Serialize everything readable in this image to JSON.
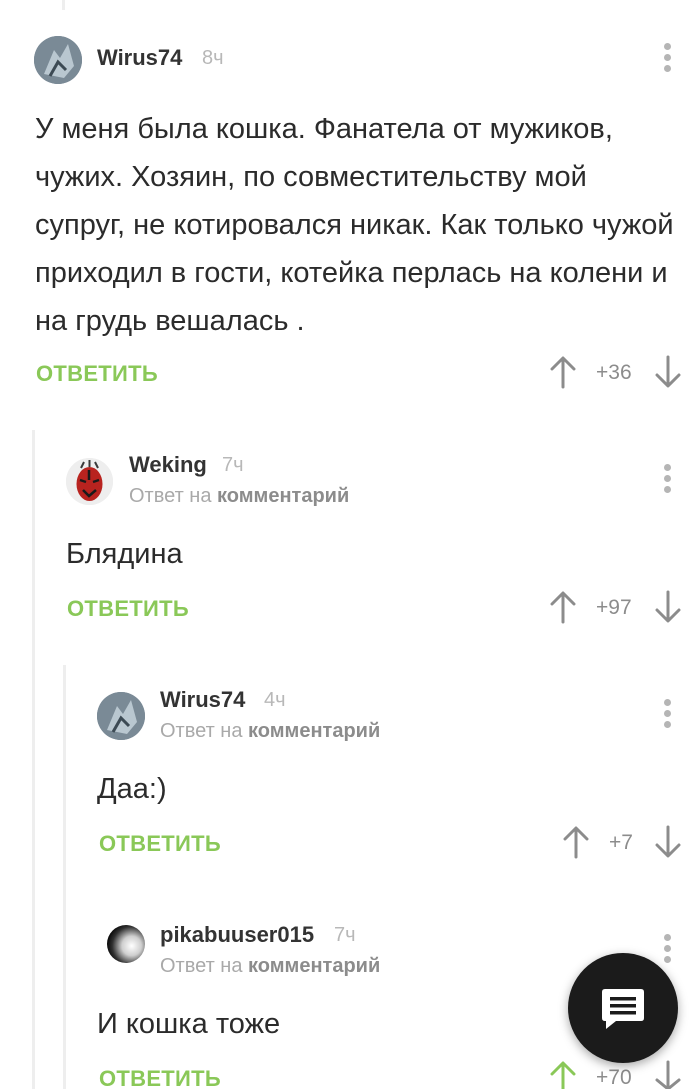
{
  "comments": [
    {
      "user": "Wirus74",
      "time": "8ч",
      "text": "У меня была кошка. Фанатела от мужиков, чужих. Хозяин, по совместительству мой супруг, не котировался никак. Как только чужой приходил в гости, котейка перлась на колени и на грудь вешалась .",
      "reply_label": "ОТВЕТИТЬ",
      "score": "+36"
    },
    {
      "user": "Weking",
      "time": "7ч",
      "reply_prefix": "Ответ на",
      "reply_target": "комментарий",
      "text": "Блядина",
      "reply_label": "ОТВЕТИТЬ",
      "score": "+97"
    },
    {
      "user": "Wirus74",
      "time": "4ч",
      "reply_prefix": "Ответ на",
      "reply_target": "комментарий",
      "text": "Даа:)",
      "reply_label": "ОТВЕТИТЬ",
      "score": "+7"
    },
    {
      "user": "pikabuuser015",
      "time": "7ч",
      "reply_prefix": "Ответ на",
      "reply_target": "комментарий",
      "text": "И кошка тоже",
      "reply_label": "ОТВЕТИТЬ",
      "score": "+70"
    }
  ],
  "icons": {
    "upvote": "arrow-up-icon",
    "downvote": "arrow-down-icon",
    "menu": "more-vertical-icon",
    "fab": "comment-icon"
  },
  "colors": {
    "accent_green": "#8ac858",
    "muted": "#a9a9a9",
    "thread_line": "#eeeeee",
    "fab_bg": "#1b1b1b"
  }
}
